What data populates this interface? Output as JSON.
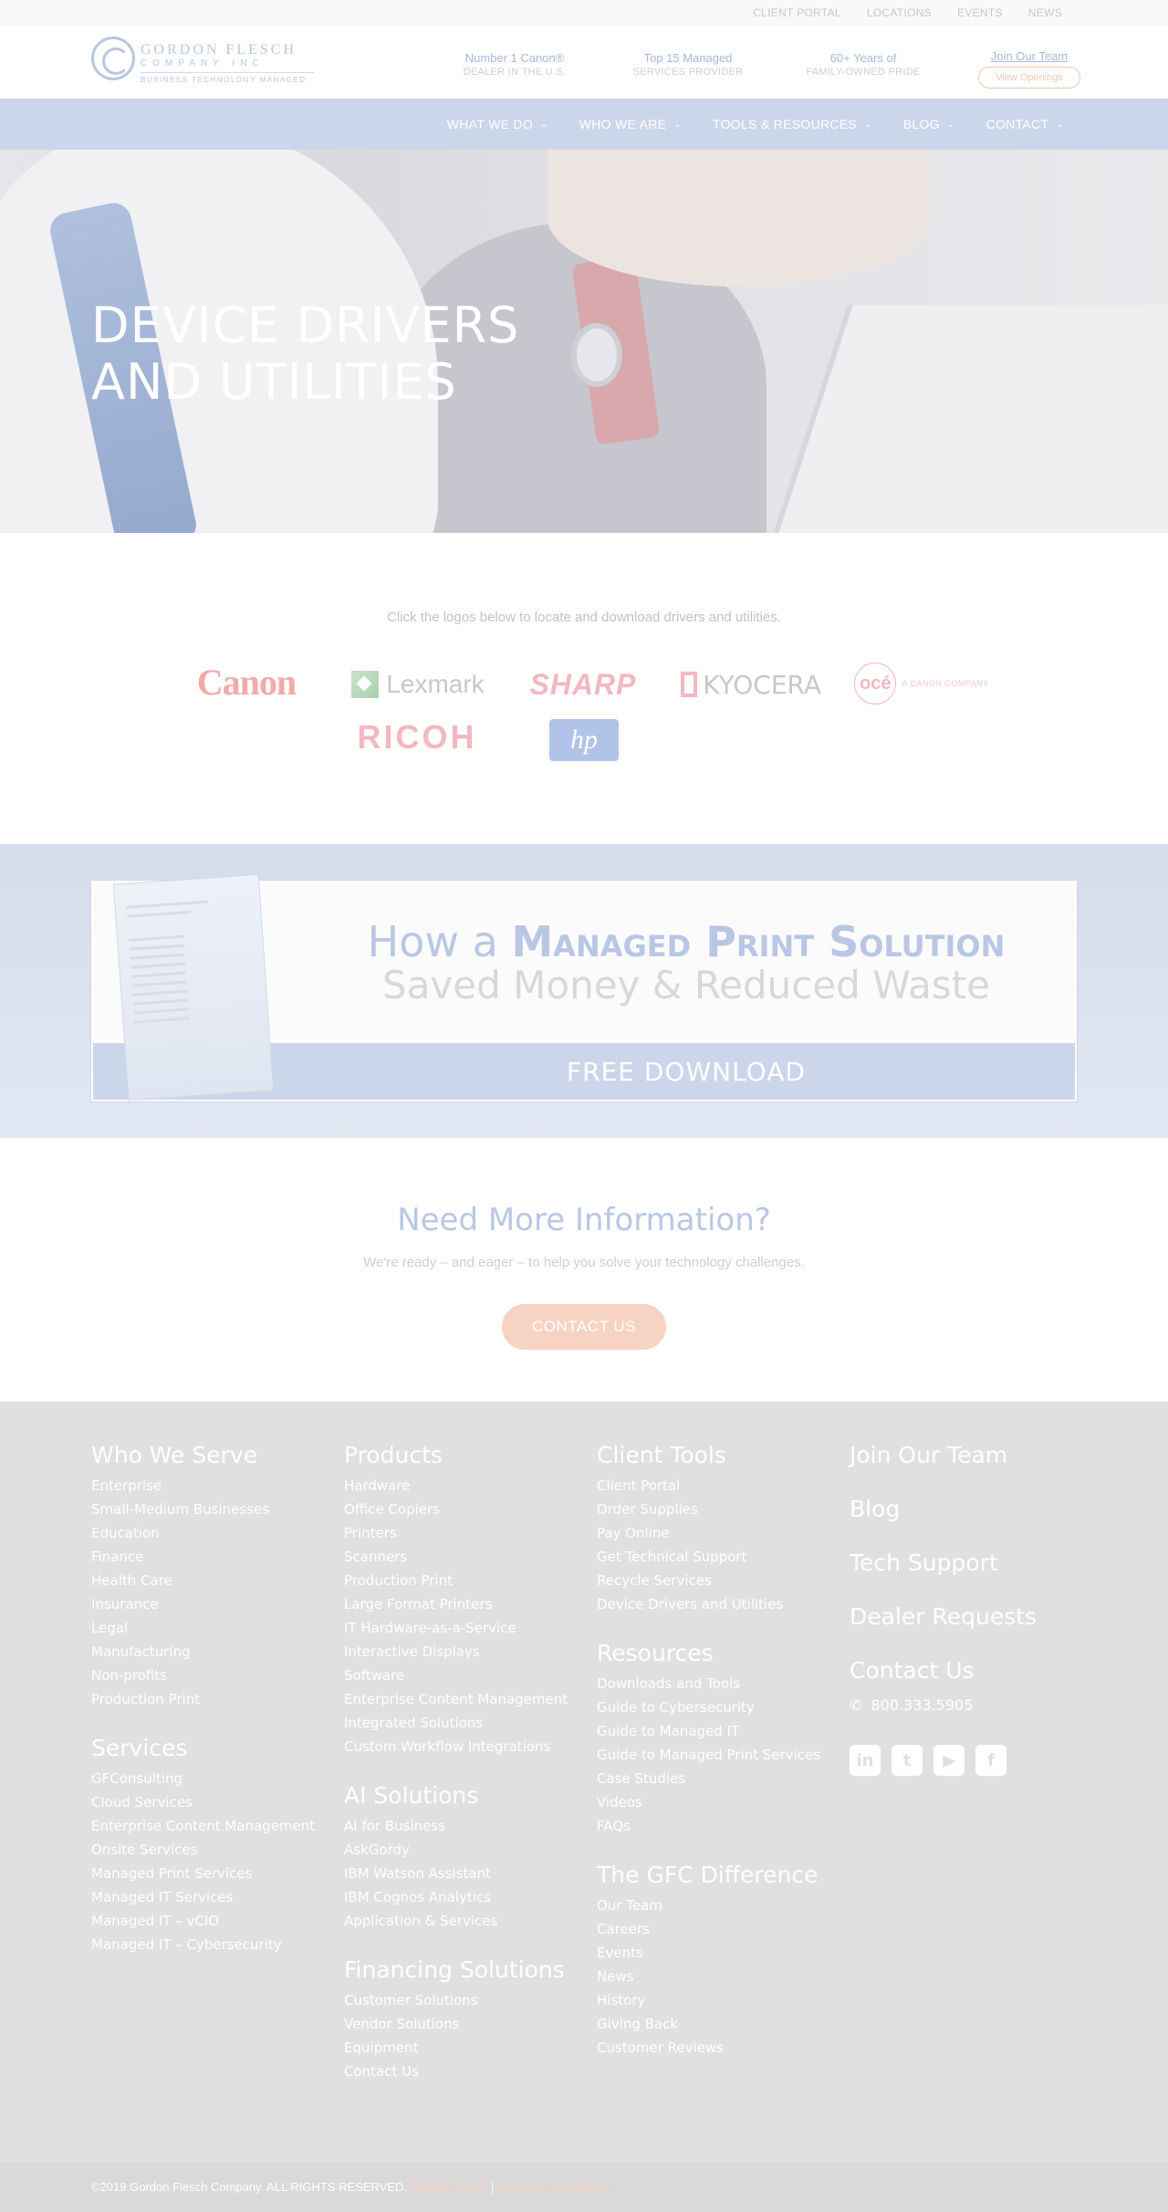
{
  "utility_nav": [
    "CLIENT PORTAL",
    "LOCATIONS",
    "EVENTS",
    "NEWS"
  ],
  "logo": {
    "name": "GORDON FLESCH",
    "company": "COMPANY INC",
    "tagline": "BUSINESS TECHNOLOGY MANAGED"
  },
  "header_stats": [
    {
      "title": "Number 1 Canon®",
      "sub": "DEALER IN THE U.S."
    },
    {
      "title": "Top 15 Managed",
      "sub": "SERVICES PROVIDER"
    },
    {
      "title": "60+ Years of",
      "sub": "FAMILY-OWNED PRIDE"
    }
  ],
  "join": {
    "title": "Join Our Team",
    "button": "View Openings"
  },
  "main_nav": [
    "WHAT WE DO",
    "WHO WE ARE",
    "TOOLS & RESOURCES",
    "BLOG",
    "CONTACT"
  ],
  "hero": {
    "title_line1": "DEVICE DRIVERS",
    "title_line2": "AND UTILITIES"
  },
  "drivers": {
    "intro": "Click the logos below to locate and download drivers and utilities.",
    "brands": {
      "canon": "Canon",
      "lexmark": "Lexmark",
      "sharp": "SHARP",
      "kyocera": "KYOCERA",
      "oce": "océ",
      "oce_sub": "A CANON COMPANY",
      "ricoh": "RICOH",
      "hp": "hp"
    }
  },
  "banner": {
    "line1_a": "How a ",
    "line1_b": "Managed Print Solution",
    "line2": "Saved Money & Reduced Waste",
    "cta": "FREE DOWNLOAD"
  },
  "cta": {
    "title": "Need More Information?",
    "text": "We're ready – and eager – to help you solve your technology challenges.",
    "button": "CONTACT US"
  },
  "footer": {
    "who_we_serve": {
      "title": "Who We Serve",
      "items": [
        "Enterprise",
        "Small-Medium Businesses",
        "Education",
        "Finance",
        "Health Care",
        "Insurance",
        "Legal",
        "Manufacturing",
        "Non-profits",
        "Production Print"
      ]
    },
    "services": {
      "title": "Services",
      "items": [
        "GFConsulting",
        "Cloud Services",
        "Enterprise Content Management",
        "Onsite Services",
        "Managed Print Services",
        "Managed IT Services",
        "Managed IT – vCIO",
        "Managed IT – Cybersecurity"
      ]
    },
    "products": {
      "title": "Products",
      "items": [
        "Hardware",
        "Office Copiers",
        "Printers",
        "Scanners",
        "Production Print",
        "Large Format Printers",
        "IT Hardware-as-a-Service",
        "Interactive Displays",
        "Software",
        "Enterprise Content Management",
        "Integrated Solutions",
        "Custom Workflow Integrations"
      ]
    },
    "ai_solutions": {
      "title": "AI Solutions",
      "items": [
        "AI for Business",
        "AskGordy",
        "IBM Watson Assistant",
        "IBM Cognos Analytics",
        "Application & Services"
      ]
    },
    "financing": {
      "title": "Financing Solutions",
      "items": [
        "Customer Solutions",
        "Vendor Solutions",
        "Equipment",
        "Contact Us"
      ]
    },
    "client_tools": {
      "title": "Client Tools",
      "items": [
        "Client Portal",
        "Order Supplies",
        "Pay Online",
        "Get Technical Support",
        "Recycle Services",
        "Device Drivers and Utilities"
      ]
    },
    "resources": {
      "title": "Resources",
      "items": [
        "Downloads and Tools",
        "Guide to Cybersecurity",
        "Guide to Managed IT",
        "Guide to Managed Print Services",
        "Case Studies",
        "Videos",
        "FAQs"
      ]
    },
    "gfc_difference": {
      "title": "The GFC Difference",
      "items": [
        "Our Team",
        "Careers",
        "Events",
        "News",
        "History",
        "Giving Back",
        "Customer Reviews"
      ]
    },
    "right_links": [
      "Join Our Team",
      "Blog",
      "Tech Support",
      "Dealer Requests"
    ],
    "contact_title": "Contact Us",
    "phone": "800.333.5905",
    "social_icons": [
      "linkedin-icon",
      "twitter-icon",
      "youtube-icon",
      "facebook-icon"
    ]
  },
  "bottom": {
    "copyright": "©2019 Gordon Flesch Company. ALL RIGHTS RESERVED. ",
    "privacy": "Website Policy",
    "sep": " | ",
    "terms": "Terms and Conditions"
  }
}
